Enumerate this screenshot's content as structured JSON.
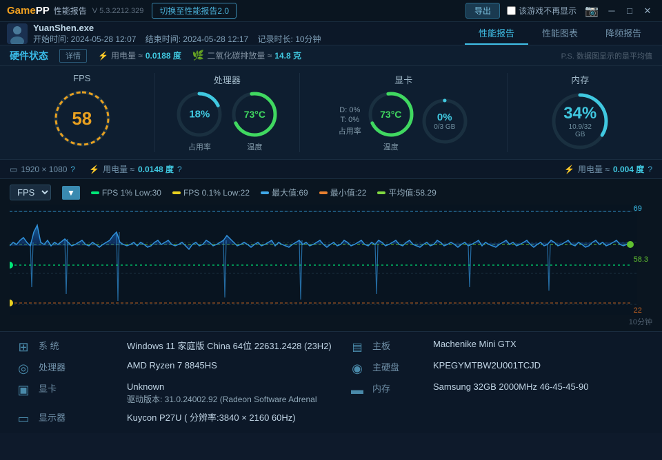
{
  "titlebar": {
    "logo": "GamePP",
    "title": "性能报告",
    "version": "V 5.3.2212.329",
    "switch_btn": "切换至性能报告2.0",
    "export_btn": "导出",
    "no_show_label": "该游戏不再显示"
  },
  "game_info": {
    "title": "YuanShen.exe",
    "start": "开始时间: 2024-05-28 12:07",
    "end": "结束时间: 2024-05-28 12:17",
    "duration": "记录时长: 10分钟"
  },
  "tabs": [
    {
      "label": "性能报告",
      "active": true
    },
    {
      "label": "性能图表",
      "active": false
    },
    {
      "label": "降频报告",
      "active": false
    }
  ],
  "hw_bar": {
    "title": "硬件状态",
    "detail_btn": "详情",
    "power_label": "用电量 ≈",
    "power_val": "0.0188 度",
    "co2_label": "二氧化碳排放量 ≈",
    "co2_val": "14.8 克",
    "note": "P.S. 数据图显示的是平均值"
  },
  "metrics": {
    "fps": {
      "label": "FPS",
      "value": "58",
      "color": "#e8a020"
    },
    "cpu": {
      "label": "处理器",
      "usage": "18%",
      "usage_sub": "占用率",
      "temp": "73°C",
      "temp_sub": "温度",
      "usage_color": "#40c8e0",
      "temp_color": "#40d860"
    },
    "gpu": {
      "label": "显卡",
      "d_usage": "D: 0%",
      "t_usage": "T: 0%",
      "usage_sub": "占用率",
      "temp": "73°C",
      "temp_sub": "温度",
      "vram": "0%",
      "vram_detail": "0/3 GB",
      "temp_color": "#40d860"
    },
    "mem": {
      "label": "内存",
      "usage": "34%",
      "detail": "10.9/32 GB",
      "color": "#40c8e0"
    }
  },
  "info_bar": {
    "resolution": "1920 × 1080",
    "cpu_power_label": "用电量 ≈",
    "cpu_power": "0.0148 度",
    "gpu_power_label": "用电量 ≈",
    "gpu_power": "0.004 度"
  },
  "chart": {
    "metric_select": "FPS",
    "legend": [
      {
        "label": "FPS 1% Low:30",
        "color": "#00e878"
      },
      {
        "label": "FPS 0.1% Low:22",
        "color": "#e8d020"
      },
      {
        "label": "最大值:69",
        "color": "#40a8e8"
      },
      {
        "label": "最小值:22",
        "color": "#e88030"
      },
      {
        "label": "平均值:58.29",
        "color": "#80d840"
      }
    ],
    "y_labels": [
      "69",
      "58.3",
      "22"
    ],
    "x_label": "10分钟",
    "max": 69,
    "min": 22,
    "avg": 58.29
  },
  "sysinfo": {
    "system": {
      "icon": "⊞",
      "label": "系 统",
      "value": "Windows 11 家庭版 China 64位 22631.2428 (23H2)"
    },
    "cpu": {
      "icon": "◎",
      "label": "处理器",
      "value": "AMD Ryzen 7 8845HS"
    },
    "gpu": {
      "icon": "▣",
      "label": "显卡",
      "value": "Unknown",
      "sub": "驱动版本: 31.0.24002.92 (Radeon Software Adrenal"
    },
    "display": {
      "icon": "▭",
      "label": "显示器",
      "value": "Kuycon P27U ( 分辨率:3840 × 2160 60Hz)"
    },
    "motherboard": {
      "icon": "▤",
      "label": "主板",
      "value": "Machenike Mini GTX"
    },
    "storage": {
      "icon": "◉",
      "label": "主硬盘",
      "value": "KPEGYMTBW2U001TCJD"
    },
    "memory": {
      "icon": "▬",
      "label": "内存",
      "value": "Samsung 32GB 2000MHz 46-45-45-90"
    }
  }
}
